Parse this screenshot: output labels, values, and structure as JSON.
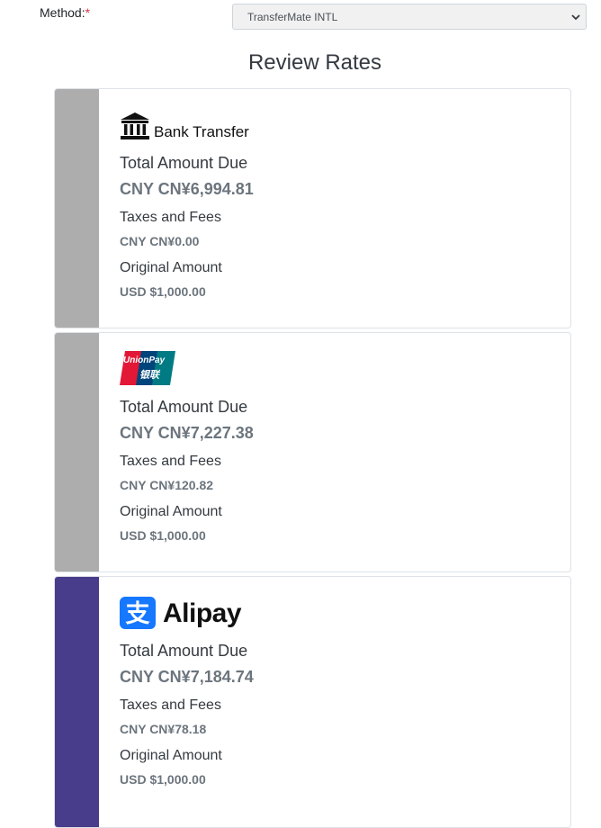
{
  "method": {
    "label": "Method:",
    "required_mark": "*",
    "selected": "TransferMate INTL"
  },
  "review": {
    "title": "Review Rates"
  },
  "colors": {
    "inactive_bar": "#adadad",
    "active_bar": "#483d8b"
  },
  "options": [
    {
      "logo_text": "Bank Transfer",
      "logo_icon": "bank-icon",
      "total_label": "Total Amount Due",
      "total_value": "CNY CN¥6,994.81",
      "taxes_label": "Taxes and Fees",
      "taxes_value": "CNY CN¥0.00",
      "original_label": "Original Amount",
      "original_value": "USD $1,000.00"
    },
    {
      "logo_text": "UnionPay",
      "logo_subtext": "银联",
      "logo_icon": "unionpay-icon",
      "total_label": "Total Amount Due",
      "total_value": "CNY CN¥7,227.38",
      "taxes_label": "Taxes and Fees",
      "taxes_value": "CNY CN¥120.82",
      "original_label": "Original Amount",
      "original_value": "USD $1,000.00"
    },
    {
      "logo_text": "Alipay",
      "logo_icon": "alipay-icon",
      "total_label": "Total Amount Due",
      "total_value": "CNY CN¥7,184.74",
      "taxes_label": "Taxes and Fees",
      "taxes_value": "CNY CN¥78.18",
      "original_label": "Original Amount",
      "original_value": "USD $1,000.00"
    }
  ]
}
